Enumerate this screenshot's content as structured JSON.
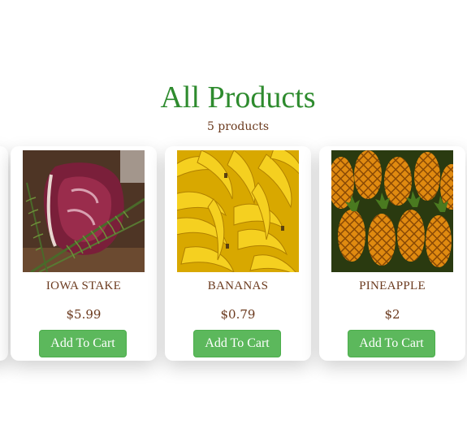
{
  "header": {
    "title": "All Products",
    "count": "5 products"
  },
  "products": [
    {
      "name": "IOWA STAKE",
      "price": "$5.99",
      "button": "Add To Cart",
      "image": "steak-with-rosemary"
    },
    {
      "name": "BANANAS",
      "price": "$0.79",
      "button": "Add To Cart",
      "image": "bananas"
    },
    {
      "name": "PINEAPPLE",
      "price": "$2",
      "button": "Add To Cart",
      "image": "pineapples"
    }
  ],
  "colors": {
    "title": "#2e8b2e",
    "text": "#6b3a1e",
    "button": "#5cb85c"
  }
}
